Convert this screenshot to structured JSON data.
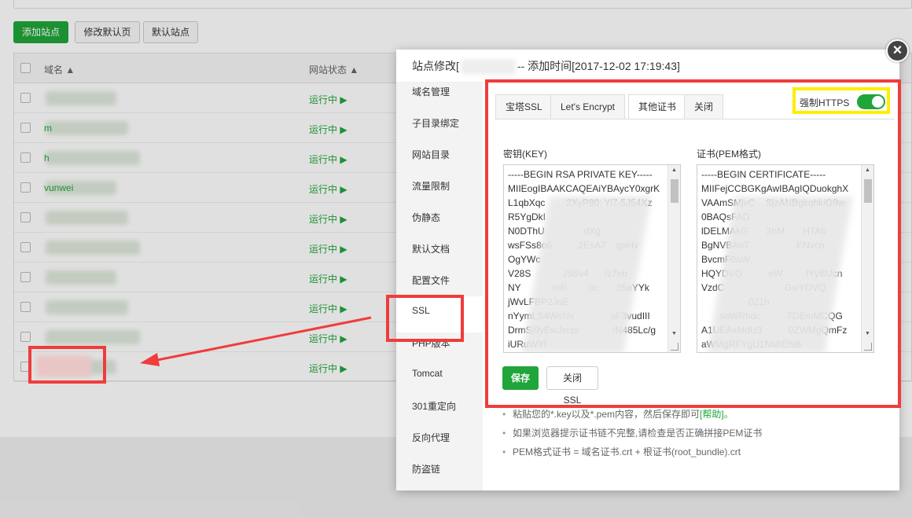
{
  "toolbar": {
    "add_site": "添加站点",
    "modify_default_page": "修改默认页",
    "default_site": "默认站点"
  },
  "site_table": {
    "columns": [
      "域名 ▲",
      "网站状态 ▲"
    ],
    "rows": [
      {
        "domain": "",
        "status": "运行中 ▶"
      },
      {
        "domain": "m",
        "status": "运行中 ▶"
      },
      {
        "domain": "h",
        "status": "运行中 ▶"
      },
      {
        "domain": "vunwei",
        "status": "运行中 ▶"
      },
      {
        "domain": "",
        "status": "运行中 ▶"
      },
      {
        "domain": "",
        "status": "运行中 ▶"
      },
      {
        "domain": "",
        "status": "运行中 ▶"
      },
      {
        "domain": "",
        "status": "运行中 ▶"
      },
      {
        "domain": "",
        "status": "运行中 ▶"
      },
      {
        "domain": "",
        "status": "运行中 ▶"
      }
    ]
  },
  "modal": {
    "title_prefix": "站点修改[",
    "title_suffix": "-- 添加时间[2017-12-02 17:19:43]",
    "close_icon": "×",
    "menu": [
      "域名管理",
      "子目录绑定",
      "网站目录",
      "流量限制",
      "伪静态",
      "默认文档",
      "配置文件",
      "SSL",
      "PHP版本",
      "Tomcat",
      "301重定向",
      "反向代理",
      "防盗链"
    ],
    "active_menu": "SSL",
    "ssl": {
      "tabs": [
        "宝塔SSL",
        "Let's Encrypt",
        "其他证书",
        "关闭"
      ],
      "active_tab": "其他证书",
      "force_https_label": "强制HTTPS",
      "force_https_on": true,
      "key_label": "密钥(KEY)",
      "cert_label": "证书(PEM格式)",
      "key_text": "-----BEGIN RSA PRIVATE KEY-----\nMIIEogIBAAKCAQEAiYBAycY0xgrK\nL1qbXqc        2XyP80: Yi7-5J54Xz\nR5YgDkI\nN0DThU               dXg\nwsFSs8o6          2EsA7    gaHv\nOgYWc\nV28S            JS6v4      /z7eb\nNY            mR        dc       35eYYk\njWvLFBP2JoE\nnYymLS4WsNv              uF3vudIII\nDrmSj9yEwJxcpi             /N485Lc/g\niURuWYf",
      "cert_text": "-----BEGIN CERTIFICATE-----\nMIIFejCCBGKgAwIBAgIQDuokghX\nVAAmSMjvC    SjzANBgkqhkiG9w\n0BAQsFAD\nlDELMAkG       3hM       HTAb\nBgNVBAoT                  ENvcn\nBvcmF0aW\nHQYDVQ          eW         lYyBUcn\nVzdC                       GwYDVQ\n                  021h\n       saWRhdc          TDEmMCQG\nA1UEAxMdU3          0ZWMgQmFz\naWMgRFYgU1NMIENB",
      "save_button": "保存",
      "close_ssl_button": "关闭SSL"
    },
    "tips": [
      {
        "text": "粘贴您的*.key以及*.pem内容，然后保存即可",
        "link": "[帮助]。"
      },
      {
        "text": "如果浏览器提示证书链不完整,请检查是否正确拼接PEM证书",
        "link": ""
      },
      {
        "text": "PEM格式证书 = 域名证书.crt + 根证书(root_bundle).crt",
        "link": ""
      }
    ]
  },
  "colors": {
    "accent": "#20a53a",
    "annotation_red": "#f03c3c",
    "annotation_yellow": "#ffee00"
  }
}
